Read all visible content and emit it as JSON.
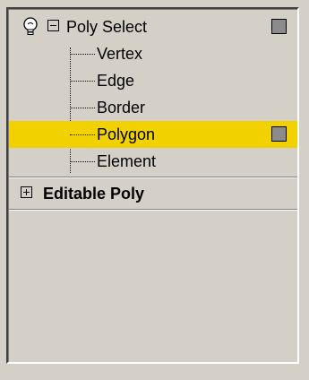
{
  "modifier_stack": {
    "poly_select": {
      "label": "Poly Select",
      "expanded": true,
      "subobjects": [
        {
          "label": "Vertex",
          "selected": false
        },
        {
          "label": "Edge",
          "selected": false
        },
        {
          "label": "Border",
          "selected": false
        },
        {
          "label": "Polygon",
          "selected": true
        },
        {
          "label": "Element",
          "selected": false
        }
      ]
    },
    "editable_poly": {
      "label": "Editable Poly",
      "expanded": false
    }
  },
  "colors": {
    "selection_highlight": "#f1d200",
    "panel_bg": "#d4d0c8",
    "swatch": "#8b8b8b"
  },
  "icons": {
    "light_bulb": "light-bulb-icon",
    "minus_box": "minus-box-icon",
    "plus_box": "plus-box-icon"
  }
}
